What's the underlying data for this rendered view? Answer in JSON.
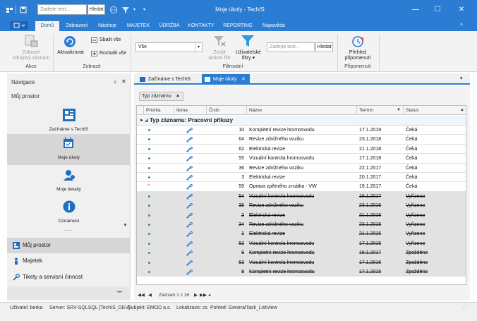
{
  "titlebar": {
    "search_placeholder": "Zadejte text...",
    "search_button": "Hledat",
    "title": "Moje úkoly - TechIS"
  },
  "ribbon": {
    "file_label": "",
    "tabs": [
      "Domů",
      "Zobrazení",
      "Nástroje",
      "MAJETEK",
      "ÚDRŽBA",
      "KONTAKTY",
      "REPORTING",
      "Nápověda"
    ],
    "akce": {
      "label": "Akce",
      "zobrazit": "Zobrazit",
      "zdrojovy": "zdrojový záznam"
    },
    "zobrazit": {
      "label": "Zobrazit",
      "aktualizovat": "Aktualizovat",
      "sbalit": "Sbalit vše",
      "rozbalit": "Rozbalit vše"
    },
    "filtrovani": {
      "label": "Filtrování",
      "combo_value": "Vše",
      "zrusit1": "Zrušit",
      "zrusit2": "aktivní filtr",
      "uzivatelske1": "Uživatelské",
      "uzivatelske2": "filtry",
      "search_placeholder": "Zadejte text...",
      "search_button": "Hledat"
    },
    "pripomenuti": {
      "label": "Připomenutí",
      "prehled1": "Přehled",
      "prehled2": "připomenutí"
    }
  },
  "nav": {
    "title": "Navigace",
    "section": "Můj prostor",
    "tiles": [
      "Začínáme s TechIS",
      "Moje úkoly",
      "Moje detaily",
      "Oznámení"
    ],
    "more": "......",
    "bottom": [
      "Můj prostor",
      "Majetek",
      "Tikety a servisní činnost"
    ],
    "footer_more": "•••"
  },
  "doctabs": [
    "Začínáme s TechIS",
    "Moje úkoly"
  ],
  "grid": {
    "group_chip": "Typ záznamu",
    "columns": [
      "Priorita",
      "Ikona",
      "Číslo",
      "Název",
      "Termín",
      "Status"
    ],
    "group_row": "Typ záznamu: Pracovní příkazy",
    "rows": [
      {
        "prio": "dot",
        "num": "10",
        "name": "Kompletní revize hromosvodu",
        "date": "17.1.2019",
        "status": "Čeká",
        "done": false
      },
      {
        "prio": "dot",
        "num": "64",
        "name": "Revize zdvižného vozíku",
        "date": "23.1.2018",
        "status": "Čeká",
        "done": false
      },
      {
        "prio": "dot",
        "num": "62",
        "name": "Elektrická revize",
        "date": "21.1.2018",
        "status": "Čeká",
        "done": false
      },
      {
        "prio": "dot",
        "num": "55",
        "name": "Vizuální kontrola hromosvodu",
        "date": "17.1.2018",
        "status": "Čeká",
        "done": false
      },
      {
        "prio": "dot",
        "num": "36",
        "name": "Revize zdvižného vozíku",
        "date": "22.1.2017",
        "status": "Čeká",
        "done": false
      },
      {
        "prio": "dot",
        "num": "3",
        "name": "Elektrická revize",
        "date": "20.1.2017",
        "status": "Čeká",
        "done": false
      },
      {
        "prio": "caret",
        "num": "59",
        "name": "Oprava zpětného zrcátka - VW",
        "date": "19.1.2017",
        "status": "Čeká",
        "done": false
      },
      {
        "prio": "dot",
        "num": "54",
        "name": "Vizuální kontrola hromosvodu",
        "date": "16.1.2017",
        "status": "Vyřízeno",
        "done": true
      },
      {
        "prio": "dot",
        "num": "35",
        "name": "Revize zdvižného vozíku",
        "date": "23.1.2016",
        "status": "Vyřízeno",
        "done": true
      },
      {
        "prio": "dot",
        "num": "2",
        "name": "Elektrická revize",
        "date": "21.1.2016",
        "status": "Vyřízeno",
        "done": true
      },
      {
        "prio": "dot",
        "num": "34",
        "name": "Revize zdvižného vozíku",
        "date": "23.1.2015",
        "status": "Vyřízeno",
        "done": true
      },
      {
        "prio": "dot",
        "num": "1",
        "name": "Elektrická revize",
        "date": "21.1.2015",
        "status": "Vyřízeno",
        "done": true
      },
      {
        "prio": "dot",
        "num": "52",
        "name": "Vizuální kontrola hromosvodu",
        "date": "17.1.2015",
        "status": "Vyřízeno",
        "done": true
      },
      {
        "prio": "dot",
        "num": "9",
        "name": "Kompletní revize hromosvodu",
        "date": "16.1.2017",
        "status": "Zpožděno",
        "done": true
      },
      {
        "prio": "dot",
        "num": "53",
        "name": "Vizuální kontrola hromosvodu",
        "date": "17.1.2016",
        "status": "Zpožděno",
        "done": true
      },
      {
        "prio": "dot",
        "num": "8",
        "name": "Kompletní revize hromosvodu",
        "date": "17.1.2015",
        "status": "Zpožděno",
        "done": true
      }
    ],
    "pager_text": "Záznam 1 z 16"
  },
  "statusbar": {
    "user": "Uživatel: berka",
    "server": "Server: SRV-SQLSQL [TechIS_DEV]",
    "subject": "Subjekt: EMOD a.s.",
    "locale": "Lokalizace: cs",
    "view": "Pohled: GeneralTask_ListView"
  },
  "colors": {
    "accent": "#2b7cd3",
    "ok_dot": "#2e9b3e",
    "tool_icon": "#2f7ccc"
  }
}
